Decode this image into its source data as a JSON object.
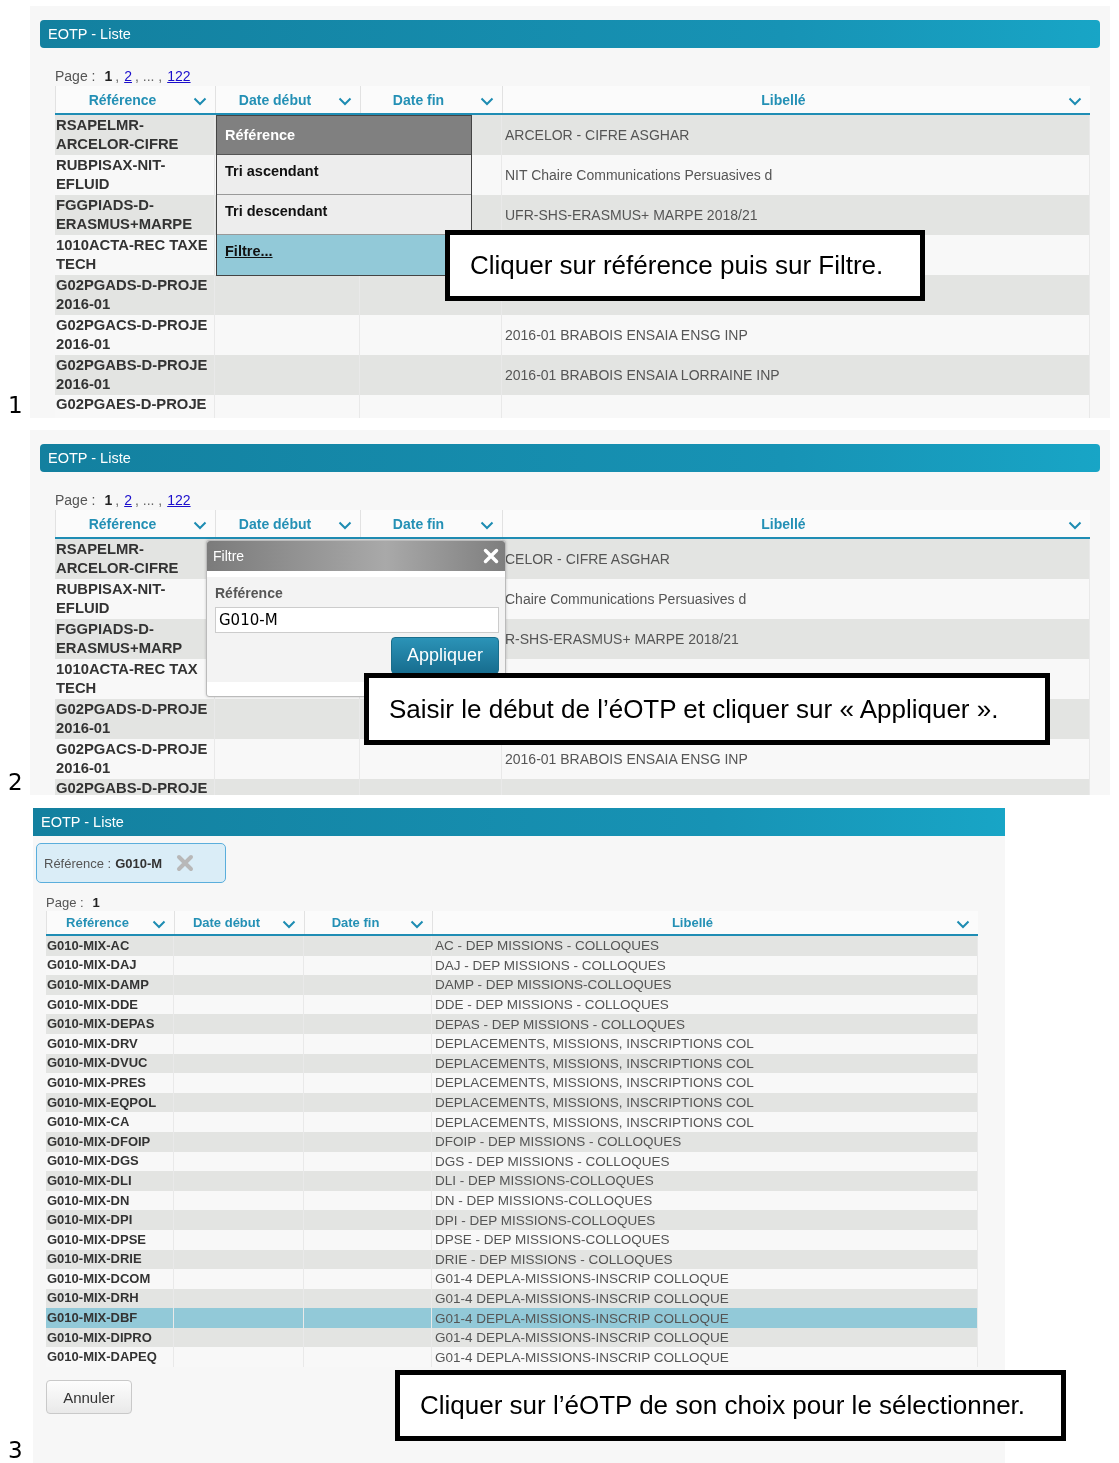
{
  "steps": [
    {
      "number": "1",
      "window_title": "EOTP - Liste",
      "page_label": "Page :",
      "pages": [
        {
          "kind": "page",
          "label": "1",
          "selected": true
        },
        {
          "kind": "separator",
          "label": ","
        },
        {
          "kind": "page",
          "label": "2",
          "selected": false
        },
        {
          "kind": "separator",
          "label": ", ... ,"
        },
        {
          "kind": "page",
          "label": "122",
          "selected": false
        }
      ],
      "columns": [
        "Référence",
        "Date début",
        "Date fin",
        "Libellé"
      ],
      "rows": [
        {
          "reference": "RSAPELMR-ARCELOR-CIFRE",
          "libelle": "ARCELOR - CIFRE ASGHAR"
        },
        {
          "reference": "RUBPISAX-NIT-EFLUID",
          "libelle": "NIT Chaire Communications Persuasives d"
        },
        {
          "reference": "FGGPIADS-D-ERASMUS+MARPE",
          "libelle": "UFR-SHS-ERASMUS+ MARPE 2018/21"
        },
        {
          "reference": "1010ACTA-REC TAXE TECH"
        },
        {
          "reference": "G02PGADS-D-PROJE 2016-01"
        },
        {
          "reference": "G02PGACS-D-PROJE 2016-01",
          "libelle": "2016-01 BRABOIS ENSAIA ENSG INP"
        },
        {
          "reference": "G02PGABS-D-PROJE 2016-01",
          "libelle": "2016-01 BRABOIS ENSAIA LORRAINE INP"
        },
        {
          "reference": "G02PGAES-D-PROJE"
        }
      ],
      "column_menu": {
        "title": "Référence",
        "items": [
          {
            "label": "Tri ascendant",
            "selected": false
          },
          {
            "label": "Tri descendant",
            "selected": false
          },
          {
            "label": "Filtre...",
            "selected": true
          }
        ]
      },
      "instruction": "Cliquer sur référence puis sur Filtre."
    },
    {
      "number": "2",
      "window_title": "EOTP - Liste",
      "page_label": "Page :",
      "pages": [
        {
          "kind": "page",
          "label": "1",
          "selected": true
        },
        {
          "kind": "separator",
          "label": ","
        },
        {
          "kind": "page",
          "label": "2",
          "selected": false
        },
        {
          "kind": "separator",
          "label": ", ... ,"
        },
        {
          "kind": "page",
          "label": "122",
          "selected": false
        }
      ],
      "columns": [
        "Référence",
        "Date début",
        "Date fin",
        "Libellé"
      ],
      "rows": [
        {
          "reference": "RSAPELMR-ARCELOR-CIFRE",
          "libelle": "CELOR - CIFRE ASGHAR"
        },
        {
          "reference": "RUBPISAX-NIT-EFLUID",
          "libelle": "Chaire Communications Persuasives d"
        },
        {
          "reference": "FGGPIADS-D-ERASMUS+MARP",
          "libelle": "R-SHS-ERASMUS+ MARPE 2018/21"
        },
        {
          "reference": "1010ACTA-REC TAX TECH"
        },
        {
          "reference": "G02PGADS-D-PROJE 2016-01"
        },
        {
          "reference": "G02PGACS-D-PROJE 2016-01",
          "libelle": "2016-01 BRABOIS ENSAIA ENSG INP"
        },
        {
          "reference": "G02PGABS-D-PROJE"
        }
      ],
      "filter_dialog": {
        "title": "Filtre",
        "field_label": "Référence",
        "value": "G010-M",
        "button": "Appliquer"
      },
      "instruction": "Saisir le début de l’éOTP et cliquer sur « Appliquer »."
    },
    {
      "number": "3",
      "window_title": "EOTP - Liste",
      "active_filter": {
        "label": "Référence :",
        "value": "G010-M"
      },
      "page_label": "Page :",
      "pages": [
        {
          "kind": "page",
          "label": "1",
          "selected": true
        }
      ],
      "columns": [
        "Référence",
        "Date début",
        "Date fin",
        "Libellé"
      ],
      "rows": [
        {
          "reference": "G010-MIX-AC",
          "libelle": "AC - DEP MISSIONS - COLLOQUES",
          "selected": false
        },
        {
          "reference": "G010-MIX-DAJ",
          "libelle": "DAJ - DEP MISSIONS - COLLOQUES",
          "selected": false
        },
        {
          "reference": "G010-MIX-DAMP",
          "libelle": "DAMP - DEP MISSIONS-COLLOQUES",
          "selected": false
        },
        {
          "reference": "G010-MIX-DDE",
          "libelle": "DDE - DEP MISSIONS - COLLOQUES",
          "selected": false
        },
        {
          "reference": "G010-MIX-DEPAS",
          "libelle": "DEPAS - DEP MISSIONS - COLLOQUES",
          "selected": false
        },
        {
          "reference": "G010-MIX-DRV",
          "libelle": "DEPLACEMENTS, MISSIONS, INSCRIPTIONS COL",
          "selected": false
        },
        {
          "reference": "G010-MIX-DVUC",
          "libelle": "DEPLACEMENTS, MISSIONS, INSCRIPTIONS COL",
          "selected": false
        },
        {
          "reference": "G010-MIX-PRES",
          "libelle": "DEPLACEMENTS, MISSIONS, INSCRIPTIONS COL",
          "selected": false
        },
        {
          "reference": "G010-MIX-EQPOL",
          "libelle": "DEPLACEMENTS, MISSIONS, INSCRIPTIONS COL",
          "selected": false
        },
        {
          "reference": "G010-MIX-CA",
          "libelle": "DEPLACEMENTS, MISSIONS, INSCRIPTIONS COL",
          "selected": false
        },
        {
          "reference": "G010-MIX-DFOIP",
          "libelle": "DFOIP - DEP MISSIONS - COLLOQUES",
          "selected": false
        },
        {
          "reference": "G010-MIX-DGS",
          "libelle": "DGS - DEP MISSIONS - COLLOQUES",
          "selected": false
        },
        {
          "reference": "G010-MIX-DLI",
          "libelle": "DLI - DEP MISSIONS-COLLOQUES",
          "selected": false
        },
        {
          "reference": "G010-MIX-DN",
          "libelle": "DN - DEP MISSIONS-COLLOQUES",
          "selected": false
        },
        {
          "reference": "G010-MIX-DPI",
          "libelle": "DPI - DEP MISSIONS-COLLOQUES",
          "selected": false
        },
        {
          "reference": "G010-MIX-DPSE",
          "libelle": "DPSE - DEP MISSIONS-COLLOQUES",
          "selected": false
        },
        {
          "reference": "G010-MIX-DRIE",
          "libelle": "DRIE - DEP MISSIONS - COLLOQUES",
          "selected": false
        },
        {
          "reference": "G010-MIX-DCOM",
          "libelle": "G01-4 DEPLA-MISSIONS-INSCRIP COLLOQUE",
          "selected": false
        },
        {
          "reference": "G010-MIX-DRH",
          "libelle": "G01-4 DEPLA-MISSIONS-INSCRIP COLLOQUE",
          "selected": false
        },
        {
          "reference": "G010-MIX-DBF",
          "libelle": "G01-4 DEPLA-MISSIONS-INSCRIP COLLOQUE",
          "selected": true
        },
        {
          "reference": "G010-MIX-DIPRO",
          "libelle": "G01-4 DEPLA-MISSIONS-INSCRIP COLLOQUE",
          "selected": false
        },
        {
          "reference": "G010-MIX-DAPEQ",
          "libelle": "G01-4 DEPLA-MISSIONS-INSCRIP COLLOQUE",
          "selected": false
        }
      ],
      "cancel_button": "Annuler",
      "instruction": "Cliquer sur l’éOTP de son choix pour le sélectionner."
    }
  ]
}
